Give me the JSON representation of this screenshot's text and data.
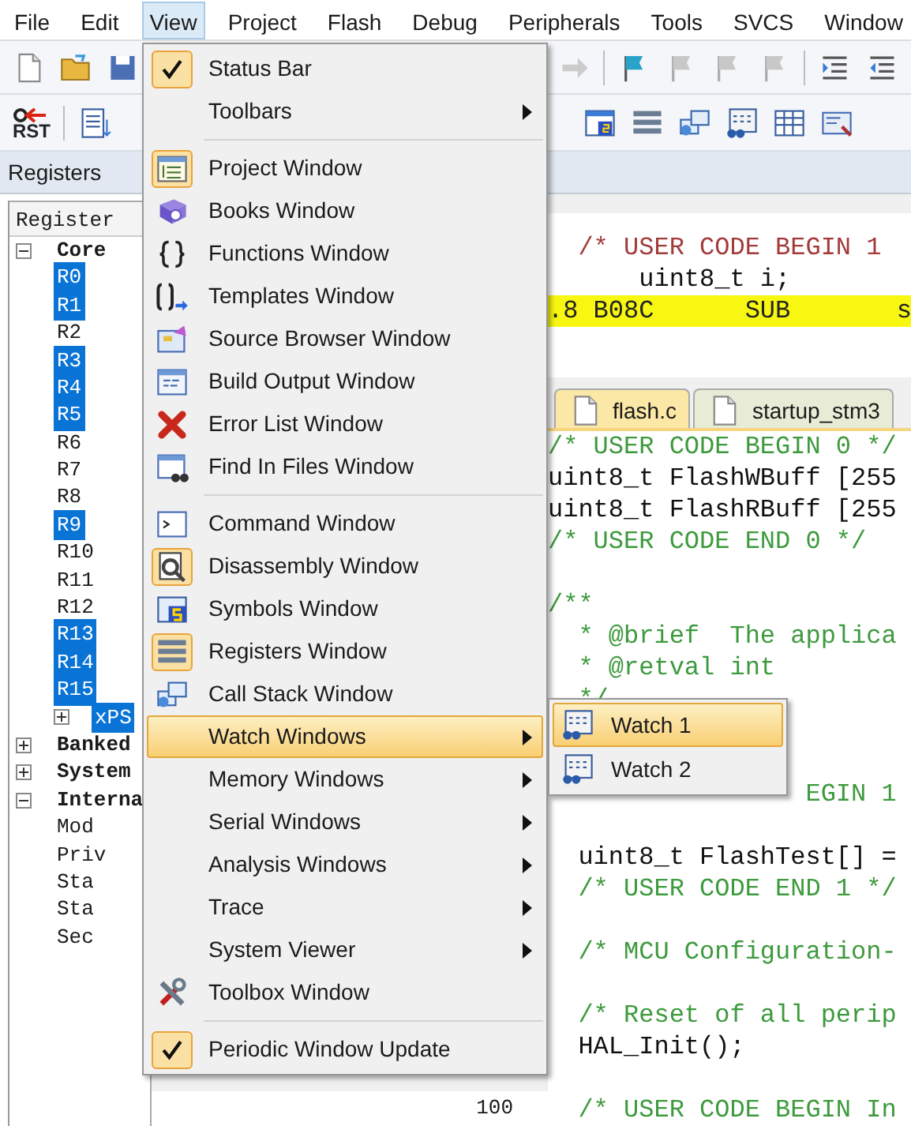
{
  "menu_bar": [
    {
      "label": "File",
      "selected": false
    },
    {
      "label": "Edit",
      "selected": false
    },
    {
      "label": "View",
      "selected": true
    },
    {
      "label": "Project",
      "selected": false
    },
    {
      "label": "Flash",
      "selected": false
    },
    {
      "label": "Debug",
      "selected": false
    },
    {
      "label": "Peripherals",
      "selected": false
    },
    {
      "label": "Tools",
      "selected": false
    },
    {
      "label": "SVCS",
      "selected": false
    },
    {
      "label": "Window",
      "selected": false
    }
  ],
  "toolbar_2": {
    "reset_label": "RST"
  },
  "registers_panel": {
    "title": "Registers",
    "column": "Register",
    "tree": [
      {
        "label": "Core",
        "expanded": true,
        "children": [
          {
            "label": "R0",
            "selected": true
          },
          {
            "label": "R1",
            "selected": true
          },
          {
            "label": "R2",
            "selected": false
          },
          {
            "label": "R3",
            "selected": true
          },
          {
            "label": "R4",
            "selected": true
          },
          {
            "label": "R5",
            "selected": true
          },
          {
            "label": "R6",
            "selected": false
          },
          {
            "label": "R7",
            "selected": false
          },
          {
            "label": "R8",
            "selected": false
          },
          {
            "label": "R9",
            "selected": true
          },
          {
            "label": "R10",
            "selected": false
          },
          {
            "label": "R11",
            "selected": false
          },
          {
            "label": "R12",
            "selected": false
          },
          {
            "label": "R13",
            "selected": true
          },
          {
            "label": "R14",
            "selected": true
          },
          {
            "label": "R15",
            "selected": true
          },
          {
            "label": "xPS",
            "selected": true,
            "expanded": false
          }
        ]
      },
      {
        "label": "Banked",
        "expanded": false
      },
      {
        "label": "System",
        "expanded": false
      },
      {
        "label": "Interna",
        "expanded": true,
        "children": [
          {
            "label": "Mod",
            "selected": false
          },
          {
            "label": "Priv",
            "selected": false
          },
          {
            "label": "Sta",
            "selected": false
          },
          {
            "label": "Sta",
            "selected": false
          },
          {
            "label": "Sec",
            "selected": false
          }
        ]
      }
    ]
  },
  "gutter": {
    "line_number": "100"
  },
  "disassembly": [
    {
      "kind": "comment",
      "text": "  /* USER CODE BEGIN 1"
    },
    {
      "kind": "code",
      "text": "      uint8_t i;"
    },
    {
      "kind": "current",
      "text": ".8 B08C      SUB       s"
    }
  ],
  "editor_tabs": [
    {
      "label": "flash.c",
      "selected": true
    },
    {
      "label": "startup_stm3",
      "selected": false
    }
  ],
  "code": [
    {
      "kind": "comment",
      "text": "/* USER CODE BEGIN 0 */"
    },
    {
      "kind": "code",
      "text": "uint8_t FlashWBuff [255"
    },
    {
      "kind": "code",
      "text": "uint8_t FlashRBuff [255"
    },
    {
      "kind": "comment",
      "text": "/* USER CODE END 0 */"
    },
    {
      "kind": "blank"
    },
    {
      "kind": "comment",
      "text": "/**"
    },
    {
      "kind": "comment",
      "text": "  * @brief  The applica"
    },
    {
      "kind": "comment",
      "text": "  * @retval int"
    },
    {
      "kind": "comment",
      "text": "  */"
    },
    {
      "kind": "blank"
    },
    {
      "kind": "blank"
    },
    {
      "kind": "comment",
      "text": "                 EGIN 1"
    },
    {
      "kind": "blank"
    },
    {
      "kind": "code",
      "text": "  uint8_t FlashTest[] ="
    },
    {
      "kind": "comment",
      "text": "  /* USER CODE END 1 */"
    },
    {
      "kind": "blank"
    },
    {
      "kind": "comment",
      "text": "  /* MCU Configuration-"
    },
    {
      "kind": "blank"
    },
    {
      "kind": "comment",
      "text": "  /* Reset of all perip"
    },
    {
      "kind": "code",
      "text": "  HAL_Init();"
    },
    {
      "kind": "blank"
    },
    {
      "kind": "comment",
      "text": "  /* USER CODE BEGIN In"
    }
  ],
  "view_menu": [
    {
      "kind": "item",
      "label": "Status Bar",
      "checked": true,
      "active": false,
      "arrow": false,
      "selected": false
    },
    {
      "kind": "item",
      "label": "Toolbars",
      "checked": false,
      "active": false,
      "arrow": true,
      "selected": false
    },
    {
      "kind": "separator"
    },
    {
      "kind": "item",
      "label": "Project Window",
      "checked": false,
      "active": true,
      "arrow": false,
      "selected": false
    },
    {
      "kind": "item",
      "label": "Books Window",
      "checked": false,
      "active": false,
      "arrow": false,
      "selected": false
    },
    {
      "kind": "item",
      "label": "Functions Window",
      "checked": false,
      "active": false,
      "arrow": false,
      "selected": false
    },
    {
      "kind": "item",
      "label": "Templates Window",
      "checked": false,
      "active": false,
      "arrow": false,
      "selected": false
    },
    {
      "kind": "item",
      "label": "Source Browser Window",
      "checked": false,
      "active": false,
      "arrow": false,
      "selected": false
    },
    {
      "kind": "item",
      "label": "Build Output Window",
      "checked": false,
      "active": false,
      "arrow": false,
      "selected": false
    },
    {
      "kind": "item",
      "label": "Error List Window",
      "checked": false,
      "active": false,
      "arrow": false,
      "selected": false
    },
    {
      "kind": "item",
      "label": "Find In Files Window",
      "checked": false,
      "active": false,
      "arrow": false,
      "selected": false
    },
    {
      "kind": "separator"
    },
    {
      "kind": "item",
      "label": "Command Window",
      "checked": false,
      "active": false,
      "arrow": false,
      "selected": false
    },
    {
      "kind": "item",
      "label": "Disassembly Window",
      "checked": false,
      "active": true,
      "arrow": false,
      "selected": false
    },
    {
      "kind": "item",
      "label": "Symbols Window",
      "checked": false,
      "active": false,
      "arrow": false,
      "selected": false
    },
    {
      "kind": "item",
      "label": "Registers Window",
      "checked": false,
      "active": true,
      "arrow": false,
      "selected": false
    },
    {
      "kind": "item",
      "label": "Call Stack Window",
      "checked": false,
      "active": false,
      "arrow": false,
      "selected": false
    },
    {
      "kind": "item",
      "label": "Watch Windows",
      "checked": false,
      "active": false,
      "arrow": true,
      "selected": true,
      "submenu": [
        {
          "label": "Watch 1",
          "selected": true
        },
        {
          "label": "Watch 2",
          "selected": false
        }
      ]
    },
    {
      "kind": "item",
      "label": "Memory Windows",
      "checked": false,
      "active": false,
      "arrow": true,
      "selected": false
    },
    {
      "kind": "item",
      "label": "Serial Windows",
      "checked": false,
      "active": false,
      "arrow": true,
      "selected": false
    },
    {
      "kind": "item",
      "label": "Analysis Windows",
      "checked": false,
      "active": false,
      "arrow": true,
      "selected": false
    },
    {
      "kind": "item",
      "label": "Trace",
      "checked": false,
      "active": false,
      "arrow": true,
      "selected": false
    },
    {
      "kind": "item",
      "label": "System Viewer",
      "checked": false,
      "active": false,
      "arrow": true,
      "selected": false
    },
    {
      "kind": "item",
      "label": "Toolbox Window",
      "checked": false,
      "active": false,
      "arrow": false,
      "selected": false
    },
    {
      "kind": "separator"
    },
    {
      "kind": "item",
      "label": "Periodic Window Update",
      "checked": true,
      "active": false,
      "arrow": false,
      "selected": false
    }
  ]
}
